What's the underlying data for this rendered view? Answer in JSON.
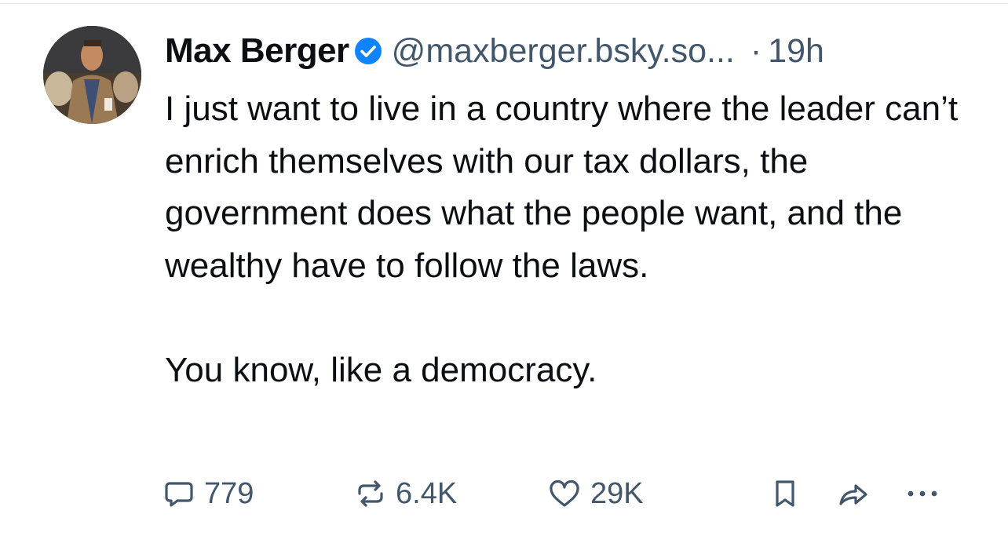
{
  "post": {
    "author": {
      "display_name": "Max Berger",
      "verified": true,
      "handle": "@maxberger.bsky.so...",
      "avatar_icon": "portrait-avatar"
    },
    "separator": "·",
    "time_ago": "19h",
    "text_paragraphs": [
      "I just want to live in a country where the leader can’t enrich themselves with our tax dollars, the government does what the people want, and the wealthy have to follow the laws.",
      "You know, like a democracy."
    ],
    "actions": {
      "reply": {
        "icon": "reply-icon",
        "count": "779"
      },
      "repost": {
        "icon": "repost-icon",
        "count": "6.4K"
      },
      "like": {
        "icon": "heart-icon",
        "count": "29K"
      },
      "bookmark": {
        "icon": "bookmark-icon"
      },
      "share": {
        "icon": "share-icon"
      },
      "more": {
        "icon": "more-icon"
      }
    }
  },
  "colors": {
    "text_primary": "#0b0f14",
    "text_secondary": "#42576c",
    "verified_blue": "#1083fe",
    "background": "#ffffff"
  }
}
